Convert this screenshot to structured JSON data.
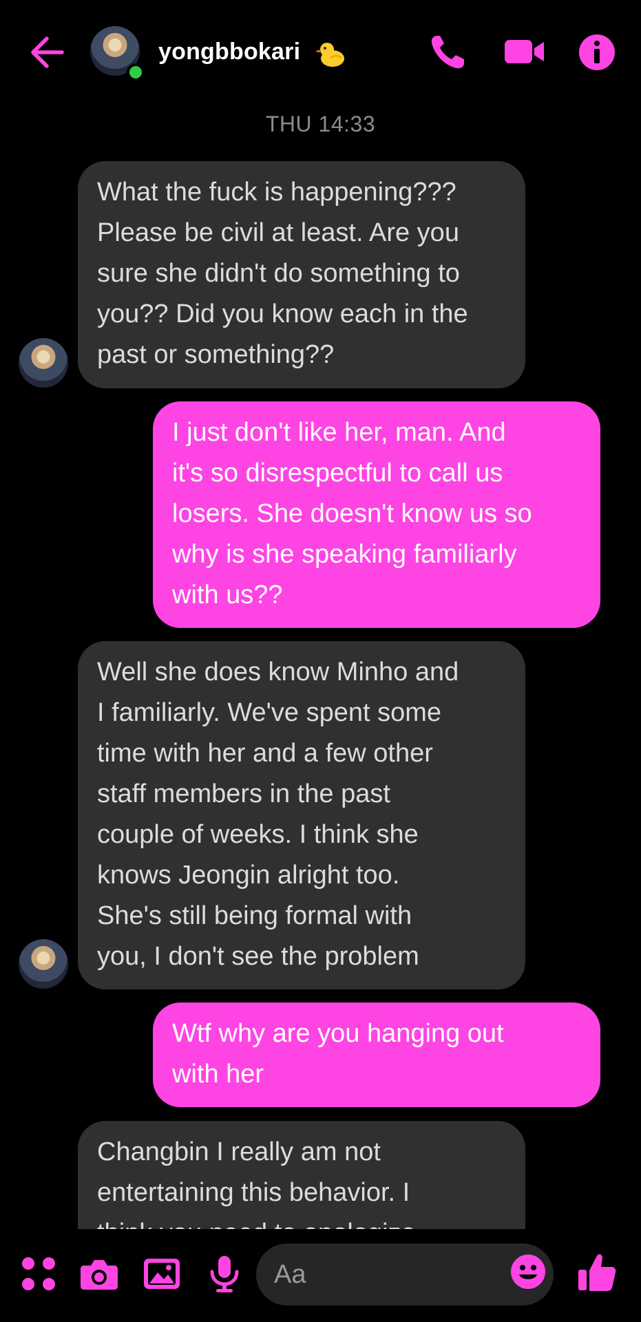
{
  "header": {
    "contact_name": "yongbbokari",
    "name_emoji": "chick-emoji"
  },
  "accent_color": "#fe44e3",
  "timestamp": "THU 14:33",
  "messages": [
    {
      "direction": "incoming",
      "text": "What the fuck is happening???\nPlease be civil at least. Are you\nsure she didn't do something to\nyou?? Did you know each in the\npast or something??"
    },
    {
      "direction": "outgoing",
      "text": "I just don't like her, man. And\nit's so disrespectful to call us\nlosers. She doesn't know us so\nwhy is she speaking familiarly\nwith us??"
    },
    {
      "direction": "incoming",
      "text": "Well she does know Minho and\nI familiarly. We've spent some\ntime with her and a few other\nstaff members in the past\ncouple of weeks. I think she\nknows Jeongin alright too.\nShe's still being formal with\nyou, I don't see the problem"
    },
    {
      "direction": "outgoing",
      "text": "Wtf why are you hanging out\nwith her"
    },
    {
      "direction": "incoming",
      "text": "Changbin I really am not\nentertaining this behavior. I\nthink you need to apologize"
    }
  ],
  "composer": {
    "placeholder": "Aa"
  }
}
